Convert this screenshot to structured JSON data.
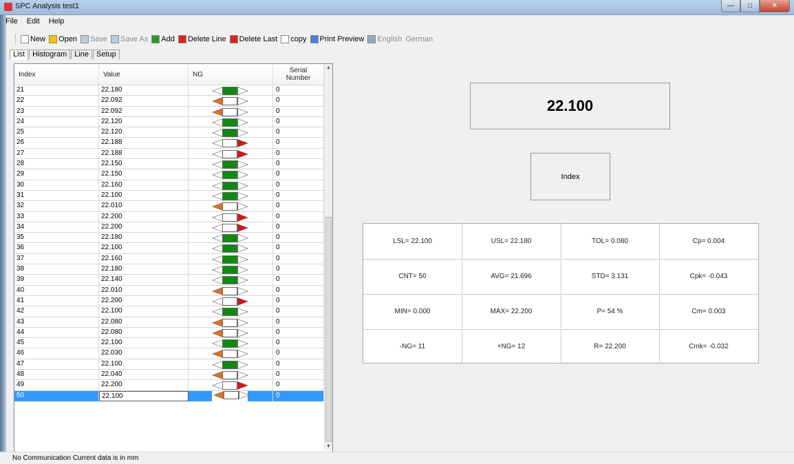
{
  "window": {
    "title": "SPC Analysis test1"
  },
  "menu": [
    "File",
    "Edit",
    "Help"
  ],
  "toolbar": [
    {
      "label": "New",
      "icon": "new-file-icon",
      "enabled": true
    },
    {
      "label": "Open",
      "icon": "open-folder-icon",
      "enabled": true
    },
    {
      "label": "Save",
      "icon": "save-icon",
      "enabled": false
    },
    {
      "label": "Save As",
      "icon": "save-as-icon",
      "enabled": false
    },
    {
      "label": "Add",
      "icon": "add-icon",
      "enabled": true
    },
    {
      "label": "Delete Line",
      "icon": "delete-line-icon",
      "enabled": true
    },
    {
      "label": "Delete Last",
      "icon": "delete-last-icon",
      "enabled": true
    },
    {
      "label": "copy",
      "icon": "copy-icon",
      "enabled": true
    },
    {
      "label": "Print Preview",
      "icon": "print-preview-icon",
      "enabled": true
    },
    {
      "label": "English",
      "icon": "language-icon",
      "enabled": false
    },
    {
      "label": "German",
      "icon": "",
      "enabled": false
    }
  ],
  "tabs": [
    "List",
    "Histogram",
    "Line",
    "Setup"
  ],
  "table": {
    "headers": {
      "index": "Index",
      "value": "Value",
      "ng": "NG",
      "serial_1": "Serial",
      "serial_2": "Number"
    },
    "rows": [
      {
        "i": "21",
        "v": "22.180",
        "s": "0",
        "ng": "ok"
      },
      {
        "i": "22",
        "v": "22.092",
        "s": "0",
        "ng": "low"
      },
      {
        "i": "23",
        "v": "22.092",
        "s": "0",
        "ng": "low"
      },
      {
        "i": "24",
        "v": "22.120",
        "s": "0",
        "ng": "ok"
      },
      {
        "i": "25",
        "v": "22.120",
        "s": "0",
        "ng": "ok"
      },
      {
        "i": "26",
        "v": "22.188",
        "s": "0",
        "ng": "high"
      },
      {
        "i": "27",
        "v": "22.188",
        "s": "0",
        "ng": "high"
      },
      {
        "i": "28",
        "v": "22.150",
        "s": "0",
        "ng": "ok"
      },
      {
        "i": "29",
        "v": "22.150",
        "s": "0",
        "ng": "ok"
      },
      {
        "i": "30",
        "v": "22.160",
        "s": "0",
        "ng": "ok"
      },
      {
        "i": "31",
        "v": "22.100",
        "s": "0",
        "ng": "ok"
      },
      {
        "i": "32",
        "v": "22.010",
        "s": "0",
        "ng": "low"
      },
      {
        "i": "33",
        "v": "22.200",
        "s": "0",
        "ng": "high"
      },
      {
        "i": "34",
        "v": "22.200",
        "s": "0",
        "ng": "high"
      },
      {
        "i": "35",
        "v": "22.180",
        "s": "0",
        "ng": "ok"
      },
      {
        "i": "36",
        "v": "22.100",
        "s": "0",
        "ng": "ok"
      },
      {
        "i": "37",
        "v": "22.160",
        "s": "0",
        "ng": "ok"
      },
      {
        "i": "38",
        "v": "22.180",
        "s": "0",
        "ng": "ok"
      },
      {
        "i": "39",
        "v": "22.140",
        "s": "0",
        "ng": "ok"
      },
      {
        "i": "40",
        "v": "22.010",
        "s": "0",
        "ng": "low"
      },
      {
        "i": "41",
        "v": "22.200",
        "s": "0",
        "ng": "high"
      },
      {
        "i": "42",
        "v": "22.100",
        "s": "0",
        "ng": "ok"
      },
      {
        "i": "43",
        "v": "22.080",
        "s": "0",
        "ng": "low"
      },
      {
        "i": "44",
        "v": "22.080",
        "s": "0",
        "ng": "low"
      },
      {
        "i": "45",
        "v": "22.100",
        "s": "0",
        "ng": "ok"
      },
      {
        "i": "46",
        "v": "22.030",
        "s": "0",
        "ng": "low"
      },
      {
        "i": "47",
        "v": "22.100",
        "s": "0",
        "ng": "ok"
      },
      {
        "i": "48",
        "v": "22.040",
        "s": "0",
        "ng": "low"
      },
      {
        "i": "49",
        "v": "22.200",
        "s": "0",
        "ng": "high"
      },
      {
        "i": "50",
        "v": "22.100",
        "s": "0",
        "ng": "low",
        "selected": true
      }
    ]
  },
  "display": {
    "current_value": "22.100",
    "index_button": "Index"
  },
  "stats": [
    [
      "LSL= 22.100",
      "USL= 22.180",
      "TOL= 0.080",
      "Cp= 0.004"
    ],
    [
      "CNT= 50",
      "AVG= 21.696",
      "STD= 3.131",
      "Cpk= -0.043"
    ],
    [
      "MIN= 0.000",
      "MAX= 22.200",
      "P= 54 %",
      "Cm= 0.003"
    ],
    [
      "-NG= 11",
      "+NG= 12",
      "R= 22.200",
      "Cmk= -0.032"
    ]
  ],
  "status": "No Communication  Current data is in mm",
  "colors": {
    "ok": "#0e8a0e",
    "low": "#e07020",
    "high": "#e01010",
    "selection": "#3399ff"
  }
}
